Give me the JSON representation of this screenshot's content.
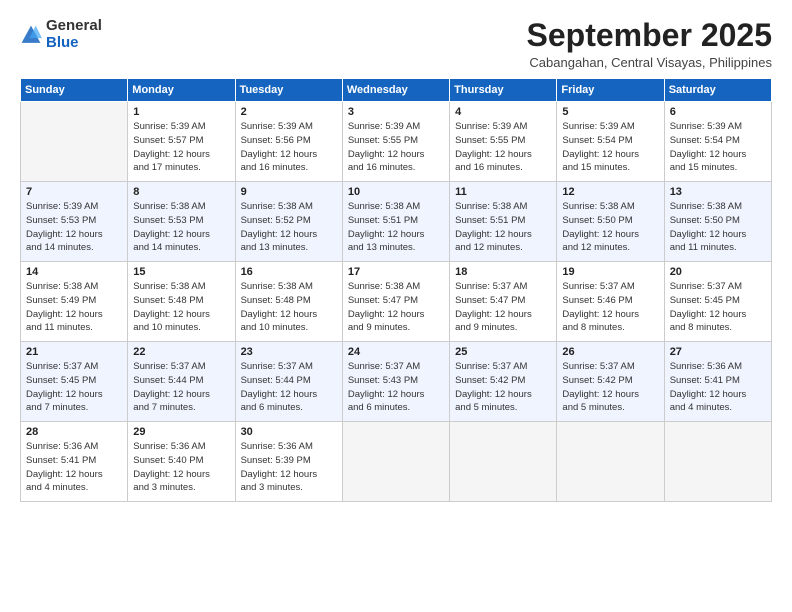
{
  "logo": {
    "general": "General",
    "blue": "Blue"
  },
  "header": {
    "month": "September 2025",
    "location": "Cabangahan, Central Visayas, Philippines"
  },
  "weekdays": [
    "Sunday",
    "Monday",
    "Tuesday",
    "Wednesday",
    "Thursday",
    "Friday",
    "Saturday"
  ],
  "weeks": [
    [
      {
        "day": "",
        "info": ""
      },
      {
        "day": "1",
        "info": "Sunrise: 5:39 AM\nSunset: 5:57 PM\nDaylight: 12 hours\nand 17 minutes."
      },
      {
        "day": "2",
        "info": "Sunrise: 5:39 AM\nSunset: 5:56 PM\nDaylight: 12 hours\nand 16 minutes."
      },
      {
        "day": "3",
        "info": "Sunrise: 5:39 AM\nSunset: 5:55 PM\nDaylight: 12 hours\nand 16 minutes."
      },
      {
        "day": "4",
        "info": "Sunrise: 5:39 AM\nSunset: 5:55 PM\nDaylight: 12 hours\nand 16 minutes."
      },
      {
        "day": "5",
        "info": "Sunrise: 5:39 AM\nSunset: 5:54 PM\nDaylight: 12 hours\nand 15 minutes."
      },
      {
        "day": "6",
        "info": "Sunrise: 5:39 AM\nSunset: 5:54 PM\nDaylight: 12 hours\nand 15 minutes."
      }
    ],
    [
      {
        "day": "7",
        "info": "Sunrise: 5:39 AM\nSunset: 5:53 PM\nDaylight: 12 hours\nand 14 minutes."
      },
      {
        "day": "8",
        "info": "Sunrise: 5:38 AM\nSunset: 5:53 PM\nDaylight: 12 hours\nand 14 minutes."
      },
      {
        "day": "9",
        "info": "Sunrise: 5:38 AM\nSunset: 5:52 PM\nDaylight: 12 hours\nand 13 minutes."
      },
      {
        "day": "10",
        "info": "Sunrise: 5:38 AM\nSunset: 5:51 PM\nDaylight: 12 hours\nand 13 minutes."
      },
      {
        "day": "11",
        "info": "Sunrise: 5:38 AM\nSunset: 5:51 PM\nDaylight: 12 hours\nand 12 minutes."
      },
      {
        "day": "12",
        "info": "Sunrise: 5:38 AM\nSunset: 5:50 PM\nDaylight: 12 hours\nand 12 minutes."
      },
      {
        "day": "13",
        "info": "Sunrise: 5:38 AM\nSunset: 5:50 PM\nDaylight: 12 hours\nand 11 minutes."
      }
    ],
    [
      {
        "day": "14",
        "info": "Sunrise: 5:38 AM\nSunset: 5:49 PM\nDaylight: 12 hours\nand 11 minutes."
      },
      {
        "day": "15",
        "info": "Sunrise: 5:38 AM\nSunset: 5:48 PM\nDaylight: 12 hours\nand 10 minutes."
      },
      {
        "day": "16",
        "info": "Sunrise: 5:38 AM\nSunset: 5:48 PM\nDaylight: 12 hours\nand 10 minutes."
      },
      {
        "day": "17",
        "info": "Sunrise: 5:38 AM\nSunset: 5:47 PM\nDaylight: 12 hours\nand 9 minutes."
      },
      {
        "day": "18",
        "info": "Sunrise: 5:37 AM\nSunset: 5:47 PM\nDaylight: 12 hours\nand 9 minutes."
      },
      {
        "day": "19",
        "info": "Sunrise: 5:37 AM\nSunset: 5:46 PM\nDaylight: 12 hours\nand 8 minutes."
      },
      {
        "day": "20",
        "info": "Sunrise: 5:37 AM\nSunset: 5:45 PM\nDaylight: 12 hours\nand 8 minutes."
      }
    ],
    [
      {
        "day": "21",
        "info": "Sunrise: 5:37 AM\nSunset: 5:45 PM\nDaylight: 12 hours\nand 7 minutes."
      },
      {
        "day": "22",
        "info": "Sunrise: 5:37 AM\nSunset: 5:44 PM\nDaylight: 12 hours\nand 7 minutes."
      },
      {
        "day": "23",
        "info": "Sunrise: 5:37 AM\nSunset: 5:44 PM\nDaylight: 12 hours\nand 6 minutes."
      },
      {
        "day": "24",
        "info": "Sunrise: 5:37 AM\nSunset: 5:43 PM\nDaylight: 12 hours\nand 6 minutes."
      },
      {
        "day": "25",
        "info": "Sunrise: 5:37 AM\nSunset: 5:42 PM\nDaylight: 12 hours\nand 5 minutes."
      },
      {
        "day": "26",
        "info": "Sunrise: 5:37 AM\nSunset: 5:42 PM\nDaylight: 12 hours\nand 5 minutes."
      },
      {
        "day": "27",
        "info": "Sunrise: 5:36 AM\nSunset: 5:41 PM\nDaylight: 12 hours\nand 4 minutes."
      }
    ],
    [
      {
        "day": "28",
        "info": "Sunrise: 5:36 AM\nSunset: 5:41 PM\nDaylight: 12 hours\nand 4 minutes."
      },
      {
        "day": "29",
        "info": "Sunrise: 5:36 AM\nSunset: 5:40 PM\nDaylight: 12 hours\nand 3 minutes."
      },
      {
        "day": "30",
        "info": "Sunrise: 5:36 AM\nSunset: 5:39 PM\nDaylight: 12 hours\nand 3 minutes."
      },
      {
        "day": "",
        "info": ""
      },
      {
        "day": "",
        "info": ""
      },
      {
        "day": "",
        "info": ""
      },
      {
        "day": "",
        "info": ""
      }
    ]
  ]
}
